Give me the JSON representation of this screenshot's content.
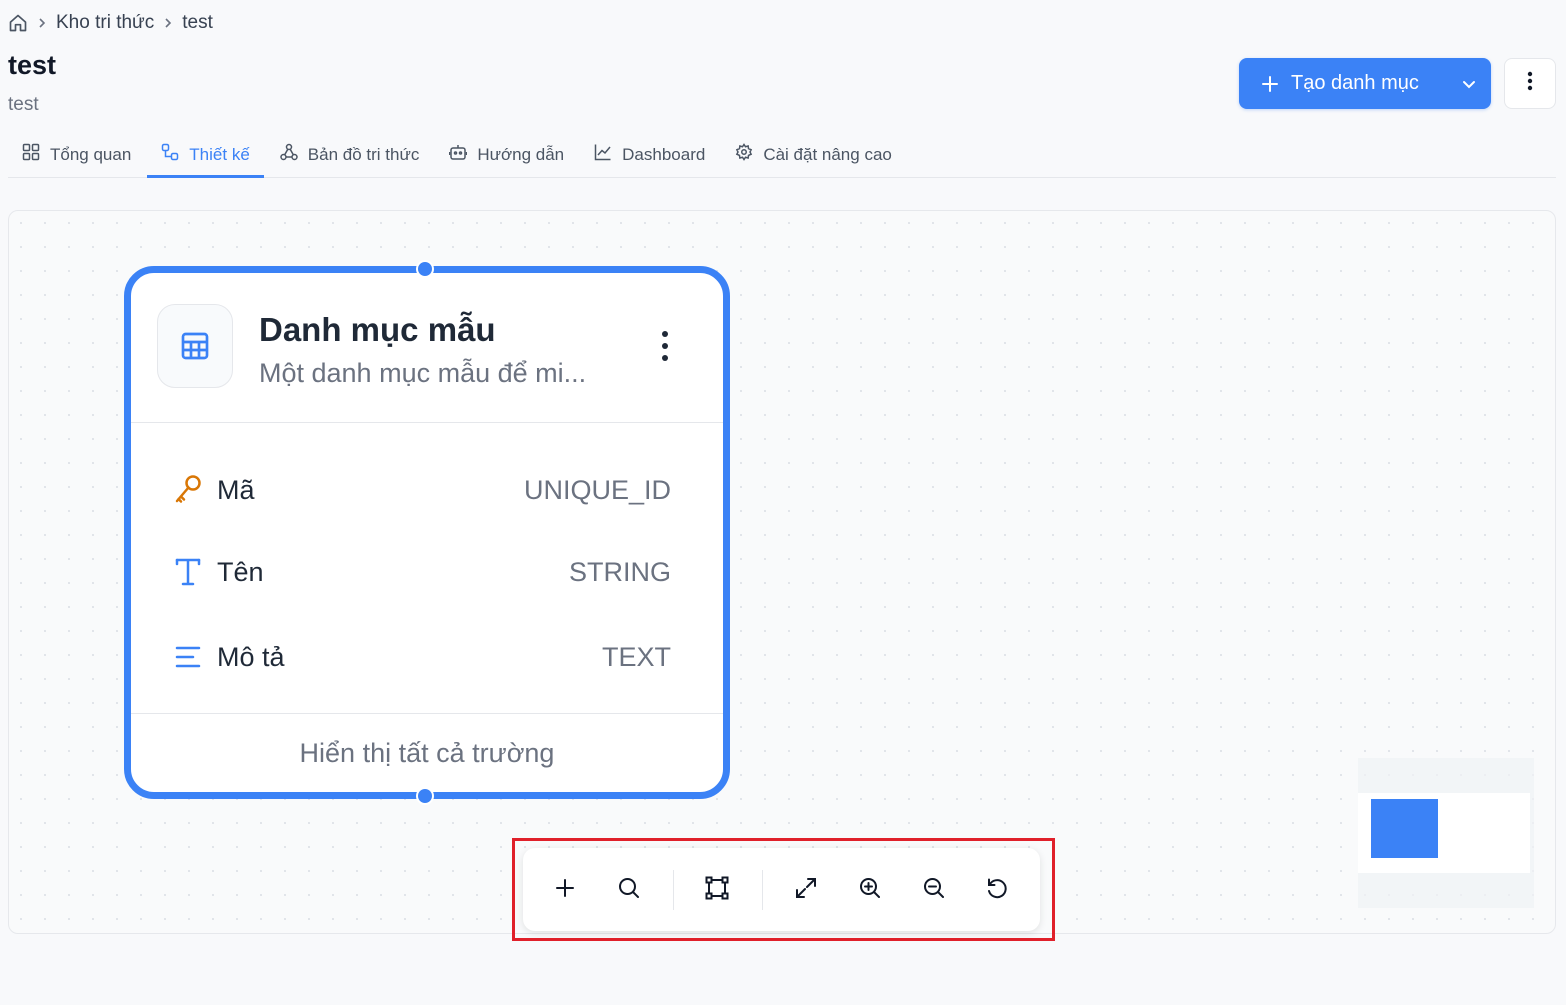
{
  "breadcrumb": {
    "home_icon": "home-icon",
    "items": [
      "Kho tri thức",
      "test"
    ]
  },
  "header": {
    "title": "test",
    "subtitle": "test",
    "create_button": "Tạo danh mục",
    "more_icon": "vertical-dots-icon"
  },
  "tabs": [
    {
      "label": "Tổng quan",
      "icon": "grid-icon",
      "active": false
    },
    {
      "label": "Thiết kế",
      "icon": "design-icon",
      "active": true
    },
    {
      "label": "Bản đồ tri thức",
      "icon": "sitemap-icon",
      "active": false
    },
    {
      "label": "Hướng dẫn",
      "icon": "robot-icon",
      "active": false
    },
    {
      "label": "Dashboard",
      "icon": "chart-line-icon",
      "active": false
    },
    {
      "label": "Cài đặt nâng cao",
      "icon": "gear-icon",
      "active": false
    }
  ],
  "node": {
    "title": "Danh mục mẫu",
    "description": "Một danh mục mẫu để mi...",
    "icon": "table-icon",
    "fields": [
      {
        "name": "Mã",
        "type": "UNIQUE_ID",
        "icon": "key-icon"
      },
      {
        "name": "Tên",
        "type": "STRING",
        "icon": "text-t-icon"
      },
      {
        "name": "Mô tả",
        "type": "TEXT",
        "icon": "lines-icon"
      }
    ],
    "footer": "Hiển thị tất cả trường"
  },
  "toolbar": {
    "buttons": [
      "plus-icon",
      "search-icon",
      "fit-selection-icon",
      "expand-icon",
      "zoom-in-icon",
      "zoom-out-icon",
      "reset-icon"
    ]
  },
  "colors": {
    "accent": "#3b82f6",
    "highlight_box": "#e0202a",
    "key_icon": "#d97706"
  }
}
